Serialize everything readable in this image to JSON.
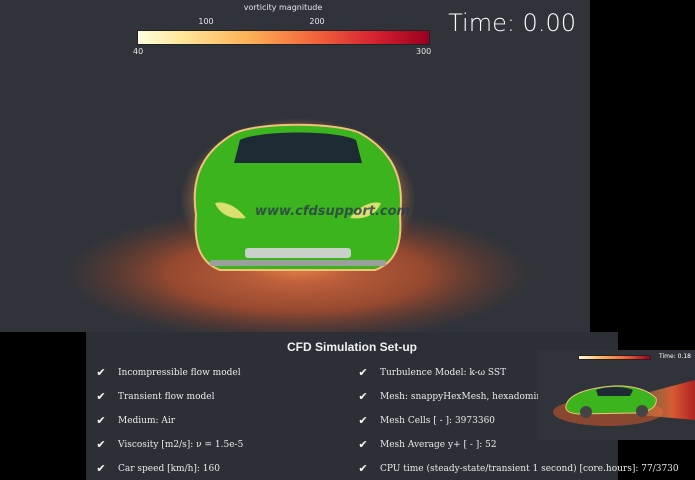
{
  "viewport": {
    "colorbar": {
      "title": "vorticity magnitude",
      "top_ticks": [
        "100",
        "200"
      ],
      "min_label": "40",
      "max_label": "300"
    },
    "time_label": "Time: 0.00",
    "watermark": "www.cfdsupport.com"
  },
  "panel": {
    "title": "CFD Simulation Set-up",
    "left_items": [
      "Incompressible flow model",
      "Transient flow model",
      "Medium: Air",
      "Viscosity [m2/s]: ν = 1.5e-5",
      "Car speed [km/h]: 160"
    ],
    "right_items": [
      "Turbulence Model: k-ω SST",
      "Mesh: snappyHexMesh, hexadominant",
      "Mesh Cells [ - ]: 3973360",
      "Mesh Average y+ [ - ]: 52",
      "CPU time (steady-state/transient 1 second) [core.hours]: 77/3730"
    ]
  },
  "thumbnail": {
    "time_label": "Time: 0.18"
  },
  "colors": {
    "car_body": "#3cb41e",
    "background": "#30343a",
    "wake": "#c0502a"
  },
  "icons": {
    "checkmark": "check-icon"
  }
}
